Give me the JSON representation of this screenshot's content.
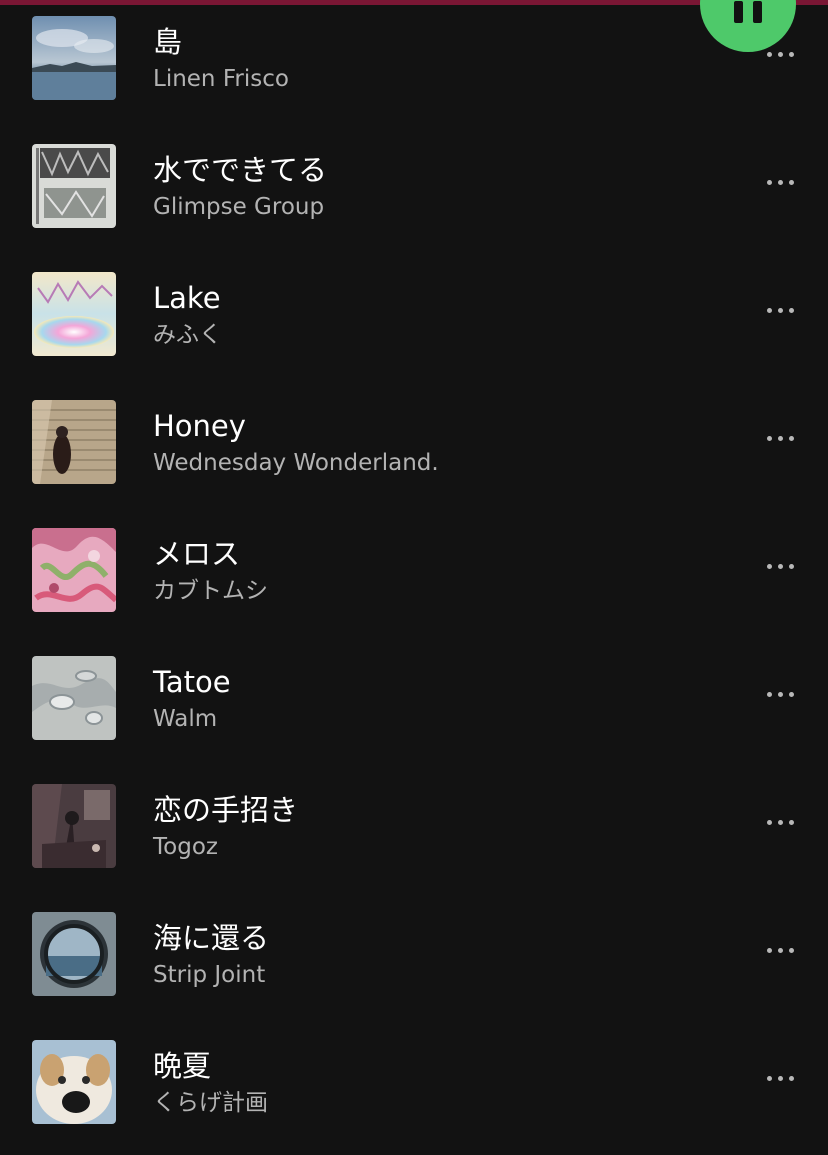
{
  "player": {
    "pause_icon": "pause-icon",
    "accent_color": "#4ec96a",
    "top_bar_color": "#7a1634"
  },
  "tracks": [
    {
      "title": "島",
      "artist": "Linen Frisco",
      "more_icon": "more-options-icon"
    },
    {
      "title": "水でできてる",
      "artist": "Glimpse Group",
      "more_icon": "more-options-icon"
    },
    {
      "title": "Lake",
      "artist": "みふく",
      "more_icon": "more-options-icon"
    },
    {
      "title": "Honey",
      "artist": "Wednesday Wonderland.",
      "more_icon": "more-options-icon"
    },
    {
      "title": "メロス",
      "artist": "カブトムシ",
      "more_icon": "more-options-icon"
    },
    {
      "title": "Tatoe",
      "artist": "Walm",
      "more_icon": "more-options-icon"
    },
    {
      "title": "恋の手招き",
      "artist": "Togoz",
      "more_icon": "more-options-icon"
    },
    {
      "title": "海に還る",
      "artist": "Strip Joint",
      "more_icon": "more-options-icon"
    },
    {
      "title": "晩夏",
      "artist": "くらげ計画",
      "more_icon": "more-options-icon"
    }
  ]
}
